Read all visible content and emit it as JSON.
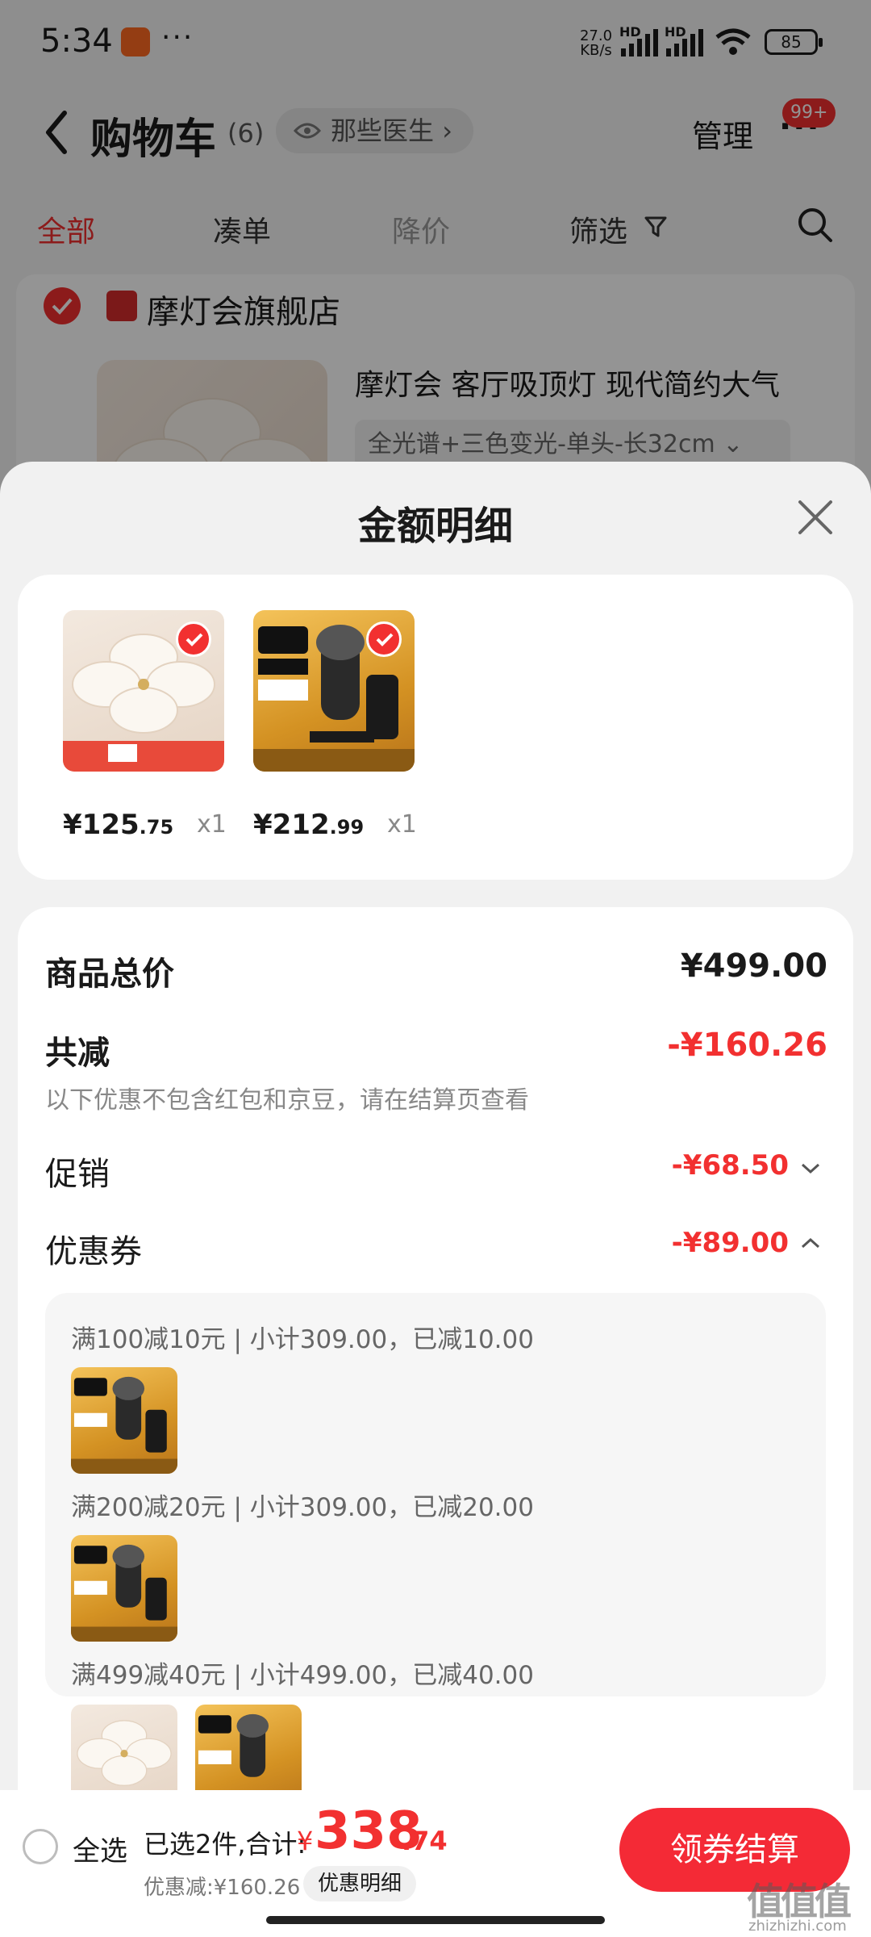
{
  "status_bar": {
    "time": "5:34",
    "dots": "···",
    "net_speed_value": "27.0",
    "net_speed_unit": "KB/s",
    "hd1": "HD",
    "hd2": "HD",
    "battery": "85"
  },
  "cart": {
    "title": "购物车",
    "count": "(6)",
    "doctor_chip": "那些医生",
    "manage": "管理",
    "more": "···",
    "msg_badge": "99+",
    "tabs": [
      "全部",
      "凑单",
      "降价",
      "筛选"
    ],
    "store_name": "摩灯会旗舰店",
    "item_title": "摩灯会 客厅吸顶灯 现代简约大气",
    "item_spec": "全光谱+三色变光-单头-长32cm"
  },
  "sheet": {
    "title": "金额明细",
    "products": [
      {
        "name": "lamp",
        "price_int": "¥125",
        "price_dec": ".75",
        "qty": "x1"
      },
      {
        "name": "shaver",
        "price_int": "¥212",
        "price_dec": ".99",
        "qty": "x1"
      }
    ],
    "details": {
      "total_label": "商品总价",
      "total_value": "¥499.00",
      "reduce_label": "共减",
      "reduce_value": "-¥160.26",
      "note": "以下优惠不包含红包和京豆，请在结算页查看",
      "promo_label": "促销",
      "promo_value": "-¥68.50",
      "coupon_label": "优惠券",
      "coupon_value": "-¥89.00",
      "coupons": [
        "满100减10元 | 小计309.00，已减10.00",
        "满200减20元 | 小计309.00，已减20.00",
        "满499减40元 | 小计499.00，已减40.00"
      ]
    }
  },
  "bottom": {
    "select_all": "全选",
    "selected": "已选2件,合计:",
    "currency": "¥",
    "total_int": "338",
    "total_dec": ".74",
    "discount": "优惠减:¥160.26",
    "detail_chip": "优惠明细",
    "checkout": "领券结算"
  },
  "watermark": {
    "main": "值值值",
    "sub": "zhizhizhi.com"
  },
  "colors": {
    "accent": "#f23030",
    "checkout": "#f42a36",
    "sheet_bg": "#f1f1f1"
  }
}
